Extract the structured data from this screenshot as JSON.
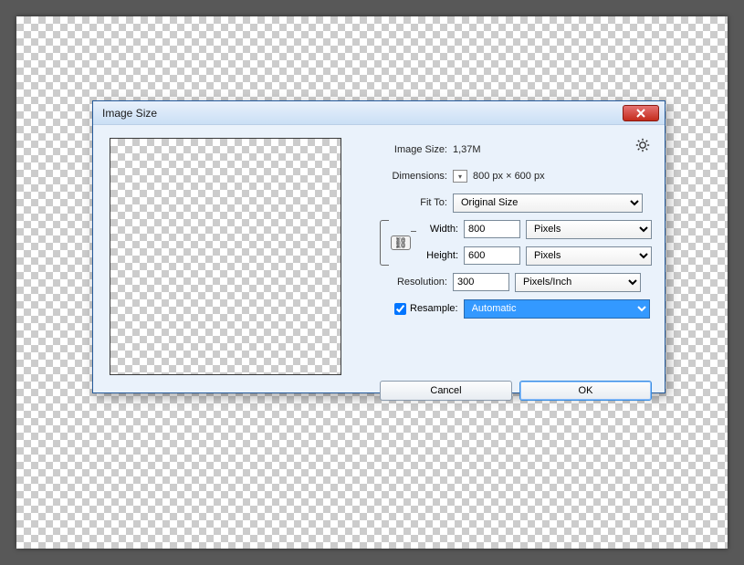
{
  "dialog": {
    "title": "Image Size",
    "imageSize": {
      "label": "Image Size:",
      "value": "1,37M"
    },
    "dimensions": {
      "label": "Dimensions:",
      "value": "800 px  ×  600 px"
    },
    "fitTo": {
      "label": "Fit To:",
      "value": "Original Size"
    },
    "width": {
      "label": "Width:",
      "value": "800",
      "unit": "Pixels"
    },
    "height": {
      "label": "Height:",
      "value": "600",
      "unit": "Pixels"
    },
    "resolution": {
      "label": "Resolution:",
      "value": "300",
      "unit": "Pixels/Inch"
    },
    "resample": {
      "label": "Resample:",
      "checked": true,
      "value": "Automatic"
    },
    "buttons": {
      "cancel": "Cancel",
      "ok": "OK"
    }
  }
}
